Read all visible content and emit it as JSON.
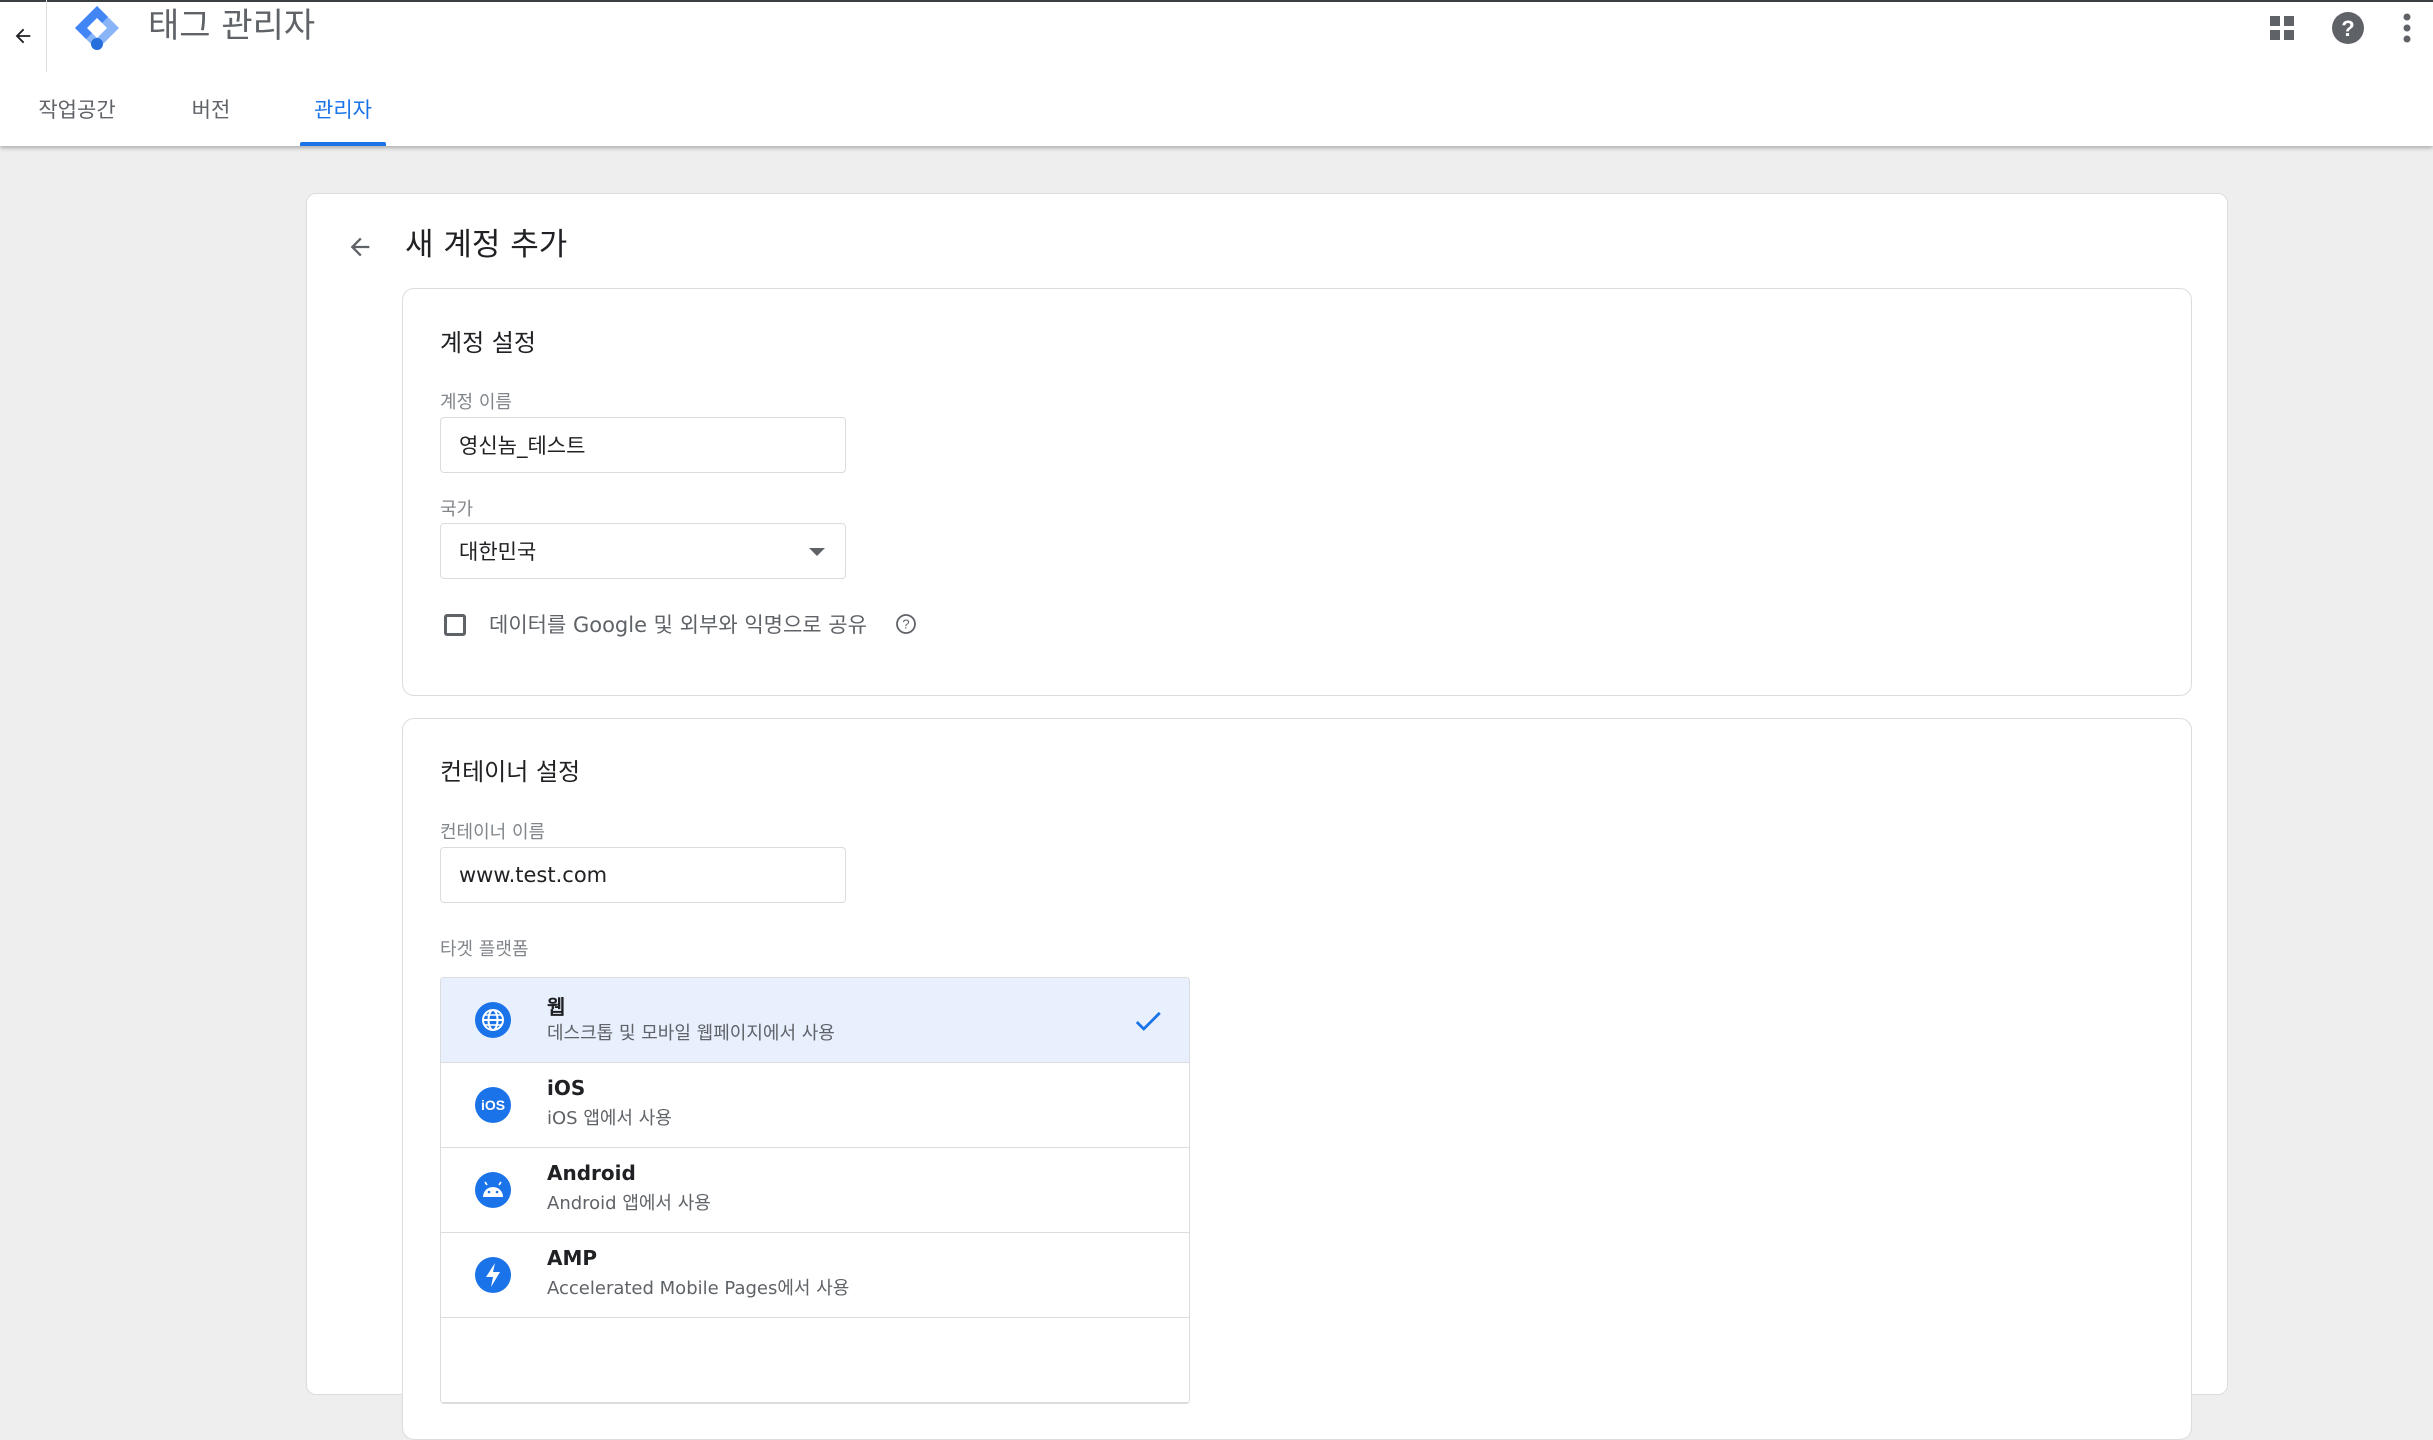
{
  "app": {
    "title": "태그 관리자"
  },
  "tabs": [
    {
      "label": "작업공간",
      "active": false
    },
    {
      "label": "버전",
      "active": false
    },
    {
      "label": "관리자",
      "active": true
    }
  ],
  "page": {
    "title": "새 계정 추가"
  },
  "account_settings": {
    "title": "계정 설정",
    "name_label": "계정 이름",
    "name_value": "영신놈_테스트",
    "country_label": "국가",
    "country_value": "대한민국",
    "share_checkbox_label": "데이터를 Google 및 외부와 익명으로 공유",
    "share_checked": false
  },
  "container_settings": {
    "title": "컨테이너 설정",
    "name_label": "컨테이너 이름",
    "name_value": "www.test.com",
    "platform_label": "타겟 플랫폼",
    "platforms": [
      {
        "name": "웹",
        "desc": "데스크톱 및 모바일 웹페이지에서 사용",
        "icon": "globe-icon",
        "selected": true
      },
      {
        "name": "iOS",
        "desc": "iOS 앱에서 사용",
        "icon": "ios-icon",
        "selected": false
      },
      {
        "name": "Android",
        "desc": "Android 앱에서 사용",
        "icon": "android-icon",
        "selected": false
      },
      {
        "name": "AMP",
        "desc": "Accelerated Mobile Pages에서 사용",
        "icon": "amp-bolt-icon",
        "selected": false
      }
    ]
  },
  "colors": {
    "accent": "#1a73e8",
    "selected_bg": "#e8f0fe",
    "page_bg": "#eeeeee"
  }
}
